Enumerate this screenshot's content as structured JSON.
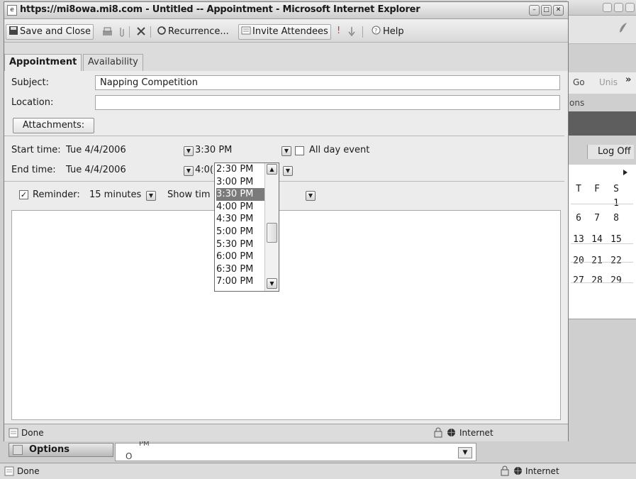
{
  "window": {
    "title": "https://mi8owa.mi8.com - Untitled -- Appointment - Microsoft Internet Explorer"
  },
  "toolbar": {
    "save_close": "Save and Close",
    "recurrence": "Recurrence...",
    "invite": "Invite Attendees",
    "help": "Help"
  },
  "tabs": {
    "appointment": "Appointment",
    "availability": "Availability"
  },
  "form": {
    "subject_label": "Subject:",
    "subject_value": "Napping Competition",
    "location_label": "Location:",
    "location_value": "",
    "attachments": "Attachments:",
    "start_label": "Start time:",
    "start_date": "Tue 4/4/2006",
    "start_time": "3:30 PM",
    "all_day_label": "All day event",
    "end_label": "End time:",
    "end_date": "Tue 4/4/2006",
    "end_time_partial": "4:0(",
    "reminder_label": "Reminder:",
    "reminder_value": "15 minutes",
    "show_time_as_partial": "Show tim"
  },
  "time_dropdown": {
    "options": [
      "2:30 PM",
      "3:00 PM",
      "3:30 PM",
      "4:00 PM",
      "4:30 PM",
      "5:00 PM",
      "5:30 PM",
      "6:00 PM",
      "6:30 PM",
      "7:00 PM"
    ],
    "selected": "3:30 PM"
  },
  "status": {
    "text": "Done",
    "zone": "Internet"
  },
  "background_window": {
    "nav_go": "Go",
    "nav_units": "Unis",
    "nav_more": "»",
    "nav_ons": "ons",
    "log_off": "Log Off",
    "calendar_headers": [
      "T",
      "F",
      "S"
    ],
    "calendar_rows": [
      [
        "",
        "",
        "1"
      ],
      [
        "6",
        "7",
        "8"
      ],
      [
        "13",
        "14",
        "15"
      ],
      [
        "20",
        "21",
        "22"
      ],
      [
        "27",
        "28",
        "29"
      ]
    ],
    "options_label": "Options",
    "field_fragment_pm": "PM",
    "field_fragment_o": "O",
    "status_text": "Done",
    "status_zone": "Internet"
  }
}
